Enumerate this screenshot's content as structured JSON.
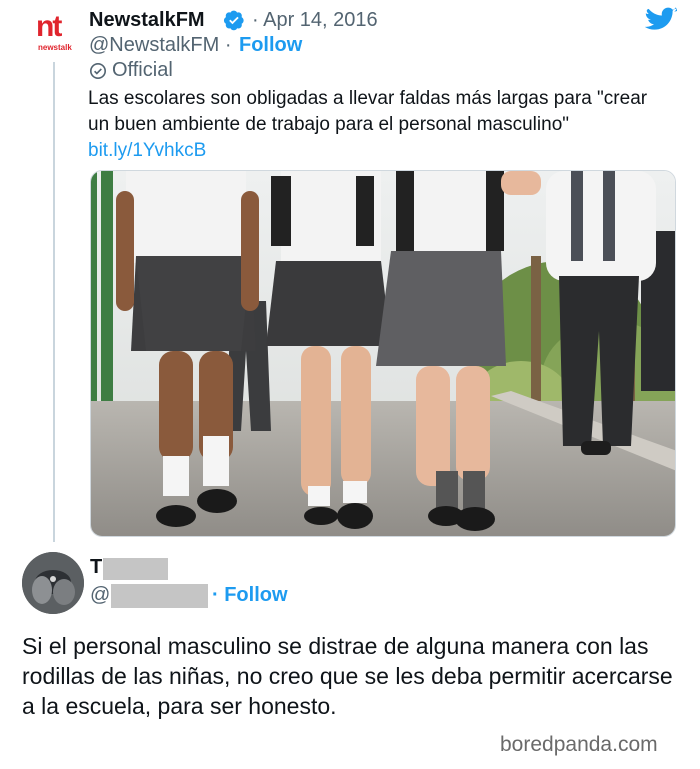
{
  "tweet": {
    "author_name": "NewstalkFM",
    "date": "· Apr 14, 2016",
    "handle": "@NewstalkFM ·",
    "follow_label": "Follow",
    "official_label": "Official",
    "logo_text": "nt",
    "logo_sub": "newstalk",
    "text": "Las escolares son obligadas a llevar faldas más largas para \"crear un buen ambiente de trabajo para el personal masculino\"",
    "link": "bit.ly/1YvhkcB",
    "accent_color": "#1d9bf0",
    "brand_color": "#e0242d",
    "photo_alt": "schoolgirls-walking-photo"
  },
  "reply": {
    "name_initial": "T",
    "handle_prefix": "@",
    "follow_label": "· Follow",
    "text": "Si el personal masculino se distrae de alguna manera con las rodillas de las niñas, no creo que se les deba permitir acercarse a la escuela, para ser honesto."
  },
  "icons": {
    "verified": "verified-badge-icon",
    "official": "official-check-icon",
    "twitter": "twitter-bird-icon"
  },
  "watermark": "boredpanda.com"
}
